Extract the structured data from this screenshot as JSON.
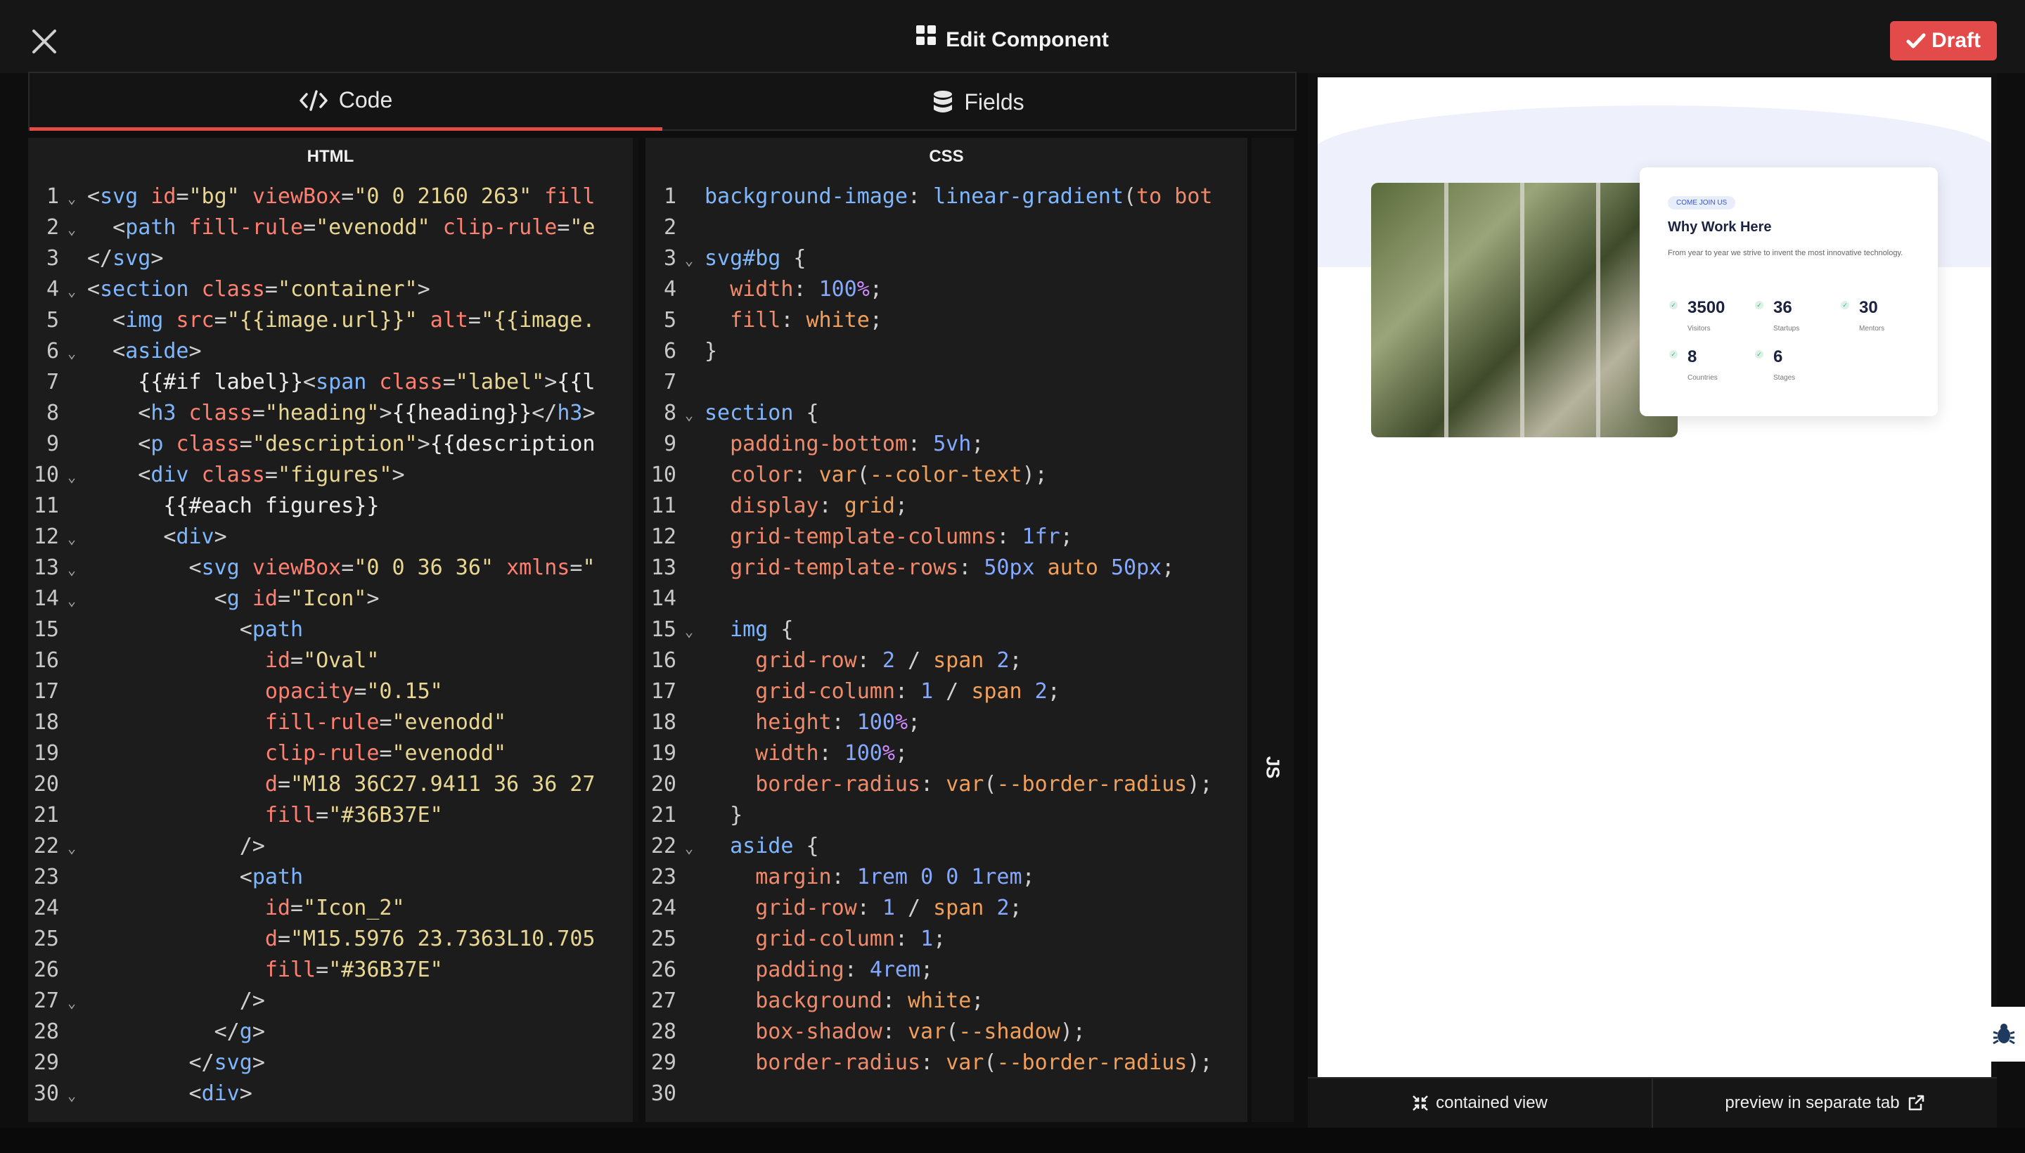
{
  "header": {
    "title": "Edit Component",
    "draft_label": "Draft"
  },
  "tabs": [
    {
      "label": "Code"
    },
    {
      "label": "Fields"
    }
  ],
  "panes": {
    "html_title": "HTML",
    "css_title": "CSS",
    "js_title": "JS"
  },
  "html_lines": [
    [
      [
        "t-punc",
        "<"
      ],
      [
        "t-tag",
        "svg"
      ],
      [
        "t-plain",
        " "
      ],
      [
        "t-attr",
        "id"
      ],
      [
        "t-punc",
        "="
      ],
      [
        "t-str",
        "\"bg\""
      ],
      [
        "t-plain",
        " "
      ],
      [
        "t-attr",
        "viewBox"
      ],
      [
        "t-punc",
        "="
      ],
      [
        "t-str",
        "\"0 0 2160 263\""
      ],
      [
        "t-plain",
        " "
      ],
      [
        "t-attr",
        "fill"
      ]
    ],
    [
      [
        "t-plain",
        "  "
      ],
      [
        "t-punc",
        "<"
      ],
      [
        "t-tag",
        "path"
      ],
      [
        "t-plain",
        " "
      ],
      [
        "t-attr",
        "fill-rule"
      ],
      [
        "t-punc",
        "="
      ],
      [
        "t-str",
        "\"evenodd\""
      ],
      [
        "t-plain",
        " "
      ],
      [
        "t-attr",
        "clip-rule"
      ],
      [
        "t-punc",
        "="
      ],
      [
        "t-str",
        "\"e"
      ]
    ],
    [
      [
        "t-punc",
        "</"
      ],
      [
        "t-tag",
        "svg"
      ],
      [
        "t-punc",
        ">"
      ]
    ],
    [
      [
        "t-punc",
        "<"
      ],
      [
        "t-tag",
        "section"
      ],
      [
        "t-plain",
        " "
      ],
      [
        "t-attr",
        "class"
      ],
      [
        "t-punc",
        "="
      ],
      [
        "t-str",
        "\"container\""
      ],
      [
        "t-punc",
        ">"
      ]
    ],
    [
      [
        "t-plain",
        "  "
      ],
      [
        "t-punc",
        "<"
      ],
      [
        "t-tag",
        "img"
      ],
      [
        "t-plain",
        " "
      ],
      [
        "t-attr",
        "src"
      ],
      [
        "t-punc",
        "="
      ],
      [
        "t-str",
        "\"{{image.url}}\""
      ],
      [
        "t-plain",
        " "
      ],
      [
        "t-attr",
        "alt"
      ],
      [
        "t-punc",
        "="
      ],
      [
        "t-str",
        "\"{{image."
      ]
    ],
    [
      [
        "t-plain",
        "  "
      ],
      [
        "t-punc",
        "<"
      ],
      [
        "t-tag",
        "aside"
      ],
      [
        "t-punc",
        ">"
      ]
    ],
    [
      [
        "t-plain",
        "    {{#if label}}"
      ],
      [
        "t-punc",
        "<"
      ],
      [
        "t-tag",
        "span"
      ],
      [
        "t-plain",
        " "
      ],
      [
        "t-attr",
        "class"
      ],
      [
        "t-punc",
        "="
      ],
      [
        "t-str",
        "\"label\""
      ],
      [
        "t-punc",
        ">"
      ],
      [
        "t-plain",
        "{{l"
      ]
    ],
    [
      [
        "t-plain",
        "    "
      ],
      [
        "t-punc",
        "<"
      ],
      [
        "t-tag",
        "h3"
      ],
      [
        "t-plain",
        " "
      ],
      [
        "t-attr",
        "class"
      ],
      [
        "t-punc",
        "="
      ],
      [
        "t-str",
        "\"heading\""
      ],
      [
        "t-punc",
        ">"
      ],
      [
        "t-plain",
        "{{heading}}"
      ],
      [
        "t-punc",
        "</"
      ],
      [
        "t-tag",
        "h3"
      ],
      [
        "t-punc",
        ">"
      ]
    ],
    [
      [
        "t-plain",
        "    "
      ],
      [
        "t-punc",
        "<"
      ],
      [
        "t-tag",
        "p"
      ],
      [
        "t-plain",
        " "
      ],
      [
        "t-attr",
        "class"
      ],
      [
        "t-punc",
        "="
      ],
      [
        "t-str",
        "\"description\""
      ],
      [
        "t-punc",
        ">"
      ],
      [
        "t-plain",
        "{{description"
      ]
    ],
    [
      [
        "t-plain",
        "    "
      ],
      [
        "t-punc",
        "<"
      ],
      [
        "t-tag",
        "div"
      ],
      [
        "t-plain",
        " "
      ],
      [
        "t-attr",
        "class"
      ],
      [
        "t-punc",
        "="
      ],
      [
        "t-str",
        "\"figures\""
      ],
      [
        "t-punc",
        ">"
      ]
    ],
    [
      [
        "t-plain",
        "      {{#each figures}}"
      ]
    ],
    [
      [
        "t-plain",
        "      "
      ],
      [
        "t-punc",
        "<"
      ],
      [
        "t-tag",
        "div"
      ],
      [
        "t-punc",
        ">"
      ]
    ],
    [
      [
        "t-plain",
        "        "
      ],
      [
        "t-punc",
        "<"
      ],
      [
        "t-tag",
        "svg"
      ],
      [
        "t-plain",
        " "
      ],
      [
        "t-attr",
        "viewBox"
      ],
      [
        "t-punc",
        "="
      ],
      [
        "t-str",
        "\"0 0 36 36\""
      ],
      [
        "t-plain",
        " "
      ],
      [
        "t-attr",
        "xmlns"
      ],
      [
        "t-punc",
        "="
      ],
      [
        "t-str",
        "\""
      ]
    ],
    [
      [
        "t-plain",
        "          "
      ],
      [
        "t-punc",
        "<"
      ],
      [
        "t-tag",
        "g"
      ],
      [
        "t-plain",
        " "
      ],
      [
        "t-attr",
        "id"
      ],
      [
        "t-punc",
        "="
      ],
      [
        "t-str",
        "\"Icon\""
      ],
      [
        "t-punc",
        ">"
      ]
    ],
    [
      [
        "t-plain",
        "            "
      ],
      [
        "t-punc",
        "<"
      ],
      [
        "t-tag",
        "path"
      ]
    ],
    [
      [
        "t-plain",
        "              "
      ],
      [
        "t-attr",
        "id"
      ],
      [
        "t-punc",
        "="
      ],
      [
        "t-str",
        "\"Oval\""
      ]
    ],
    [
      [
        "t-plain",
        "              "
      ],
      [
        "t-attr",
        "opacity"
      ],
      [
        "t-punc",
        "="
      ],
      [
        "t-str",
        "\"0.15\""
      ]
    ],
    [
      [
        "t-plain",
        "              "
      ],
      [
        "t-attr",
        "fill-rule"
      ],
      [
        "t-punc",
        "="
      ],
      [
        "t-str",
        "\"evenodd\""
      ]
    ],
    [
      [
        "t-plain",
        "              "
      ],
      [
        "t-attr",
        "clip-rule"
      ],
      [
        "t-punc",
        "="
      ],
      [
        "t-str",
        "\"evenodd\""
      ]
    ],
    [
      [
        "t-plain",
        "              "
      ],
      [
        "t-attr",
        "d"
      ],
      [
        "t-punc",
        "="
      ],
      [
        "t-str",
        "\"M18 36C27.9411 36 36 27"
      ]
    ],
    [
      [
        "t-plain",
        "              "
      ],
      [
        "t-attr",
        "fill"
      ],
      [
        "t-punc",
        "="
      ],
      [
        "t-str",
        "\"#36B37E\""
      ]
    ],
    [
      [
        "t-plain",
        "            "
      ],
      [
        "t-punc",
        "/>"
      ]
    ],
    [
      [
        "t-plain",
        "            "
      ],
      [
        "t-punc",
        "<"
      ],
      [
        "t-tag",
        "path"
      ]
    ],
    [
      [
        "t-plain",
        "              "
      ],
      [
        "t-attr",
        "id"
      ],
      [
        "t-punc",
        "="
      ],
      [
        "t-str",
        "\"Icon_2\""
      ]
    ],
    [
      [
        "t-plain",
        "              "
      ],
      [
        "t-attr",
        "d"
      ],
      [
        "t-punc",
        "="
      ],
      [
        "t-str",
        "\"M15.5976 23.7363L10.705"
      ]
    ],
    [
      [
        "t-plain",
        "              "
      ],
      [
        "t-attr",
        "fill"
      ],
      [
        "t-punc",
        "="
      ],
      [
        "t-str",
        "\"#36B37E\""
      ]
    ],
    [
      [
        "t-plain",
        "            "
      ],
      [
        "t-punc",
        "/>"
      ]
    ],
    [
      [
        "t-plain",
        "          "
      ],
      [
        "t-punc",
        "</"
      ],
      [
        "t-tag",
        "g"
      ],
      [
        "t-punc",
        ">"
      ]
    ],
    [
      [
        "t-plain",
        "        "
      ],
      [
        "t-punc",
        "</"
      ],
      [
        "t-tag",
        "svg"
      ],
      [
        "t-punc",
        ">"
      ]
    ],
    [
      [
        "t-plain",
        "        "
      ],
      [
        "t-punc",
        "<"
      ],
      [
        "t-tag",
        "div"
      ],
      [
        "t-punc",
        ">"
      ]
    ]
  ],
  "html_folds": [
    1,
    2,
    4,
    6,
    10,
    12,
    13,
    14,
    22,
    27,
    30
  ],
  "css_lines": [
    [
      [
        "t-fn",
        "background-image"
      ],
      [
        "t-punc",
        ": "
      ],
      [
        "t-fn",
        "linear-gradient"
      ],
      [
        "t-punc",
        "("
      ],
      [
        "t-kw",
        "to bot"
      ]
    ],
    [],
    [
      [
        "t-fn",
        "svg#bg"
      ],
      [
        "t-punc",
        " {"
      ]
    ],
    [
      [
        "t-plain",
        "  "
      ],
      [
        "t-kw",
        "width"
      ],
      [
        "t-punc",
        ": "
      ],
      [
        "t-num",
        "100"
      ],
      [
        "t-pct",
        "%"
      ],
      [
        "t-punc",
        ";"
      ]
    ],
    [
      [
        "t-plain",
        "  "
      ],
      [
        "t-kw",
        "fill"
      ],
      [
        "t-punc",
        ": "
      ],
      [
        "t-val",
        "white"
      ],
      [
        "t-punc",
        ";"
      ]
    ],
    [
      [
        "t-punc",
        "}"
      ]
    ],
    [],
    [
      [
        "t-fn",
        "section"
      ],
      [
        "t-punc",
        " {"
      ]
    ],
    [
      [
        "t-plain",
        "  "
      ],
      [
        "t-kw",
        "padding-bottom"
      ],
      [
        "t-punc",
        ": "
      ],
      [
        "t-num",
        "5vh"
      ],
      [
        "t-punc",
        ";"
      ]
    ],
    [
      [
        "t-plain",
        "  "
      ],
      [
        "t-kw",
        "color"
      ],
      [
        "t-punc",
        ": "
      ],
      [
        "t-val",
        "var"
      ],
      [
        "t-punc",
        "("
      ],
      [
        "t-val",
        "--color-text"
      ],
      [
        "t-punc",
        ");"
      ]
    ],
    [
      [
        "t-plain",
        "  "
      ],
      [
        "t-kw",
        "display"
      ],
      [
        "t-punc",
        ": "
      ],
      [
        "t-val",
        "grid"
      ],
      [
        "t-punc",
        ";"
      ]
    ],
    [
      [
        "t-plain",
        "  "
      ],
      [
        "t-kw",
        "grid-template-columns"
      ],
      [
        "t-punc",
        ": "
      ],
      [
        "t-num",
        "1fr"
      ],
      [
        "t-punc",
        ";"
      ]
    ],
    [
      [
        "t-plain",
        "  "
      ],
      [
        "t-kw",
        "grid-template-rows"
      ],
      [
        "t-punc",
        ": "
      ],
      [
        "t-num",
        "50px"
      ],
      [
        "t-plain",
        " "
      ],
      [
        "t-val",
        "auto"
      ],
      [
        "t-plain",
        " "
      ],
      [
        "t-num",
        "50px"
      ],
      [
        "t-punc",
        ";"
      ]
    ],
    [],
    [
      [
        "t-plain",
        "  "
      ],
      [
        "t-fn",
        "img"
      ],
      [
        "t-punc",
        " {"
      ]
    ],
    [
      [
        "t-plain",
        "    "
      ],
      [
        "t-kw",
        "grid-row"
      ],
      [
        "t-punc",
        ": "
      ],
      [
        "t-num",
        "2"
      ],
      [
        "t-punc",
        " / "
      ],
      [
        "t-val",
        "span"
      ],
      [
        "t-plain",
        " "
      ],
      [
        "t-num",
        "2"
      ],
      [
        "t-punc",
        ";"
      ]
    ],
    [
      [
        "t-plain",
        "    "
      ],
      [
        "t-kw",
        "grid-column"
      ],
      [
        "t-punc",
        ": "
      ],
      [
        "t-num",
        "1"
      ],
      [
        "t-punc",
        " / "
      ],
      [
        "t-val",
        "span"
      ],
      [
        "t-plain",
        " "
      ],
      [
        "t-num",
        "2"
      ],
      [
        "t-punc",
        ";"
      ]
    ],
    [
      [
        "t-plain",
        "    "
      ],
      [
        "t-kw",
        "height"
      ],
      [
        "t-punc",
        ": "
      ],
      [
        "t-num",
        "100"
      ],
      [
        "t-pct",
        "%"
      ],
      [
        "t-punc",
        ";"
      ]
    ],
    [
      [
        "t-plain",
        "    "
      ],
      [
        "t-kw",
        "width"
      ],
      [
        "t-punc",
        ": "
      ],
      [
        "t-num",
        "100"
      ],
      [
        "t-pct",
        "%"
      ],
      [
        "t-punc",
        ";"
      ]
    ],
    [
      [
        "t-plain",
        "    "
      ],
      [
        "t-kw",
        "border-radius"
      ],
      [
        "t-punc",
        ": "
      ],
      [
        "t-val",
        "var"
      ],
      [
        "t-punc",
        "("
      ],
      [
        "t-val",
        "--border-radius"
      ],
      [
        "t-punc",
        ");"
      ]
    ],
    [
      [
        "t-plain",
        "  "
      ],
      [
        "t-punc",
        "}"
      ]
    ],
    [
      [
        "t-plain",
        "  "
      ],
      [
        "t-fn",
        "aside"
      ],
      [
        "t-punc",
        " {"
      ]
    ],
    [
      [
        "t-plain",
        "    "
      ],
      [
        "t-kw",
        "margin"
      ],
      [
        "t-punc",
        ": "
      ],
      [
        "t-num",
        "1rem"
      ],
      [
        "t-plain",
        " "
      ],
      [
        "t-num",
        "0"
      ],
      [
        "t-plain",
        " "
      ],
      [
        "t-num",
        "0"
      ],
      [
        "t-plain",
        " "
      ],
      [
        "t-num",
        "1rem"
      ],
      [
        "t-punc",
        ";"
      ]
    ],
    [
      [
        "t-plain",
        "    "
      ],
      [
        "t-kw",
        "grid-row"
      ],
      [
        "t-punc",
        ": "
      ],
      [
        "t-num",
        "1"
      ],
      [
        "t-punc",
        " / "
      ],
      [
        "t-val",
        "span"
      ],
      [
        "t-plain",
        " "
      ],
      [
        "t-num",
        "2"
      ],
      [
        "t-punc",
        ";"
      ]
    ],
    [
      [
        "t-plain",
        "    "
      ],
      [
        "t-kw",
        "grid-column"
      ],
      [
        "t-punc",
        ": "
      ],
      [
        "t-num",
        "1"
      ],
      [
        "t-punc",
        ";"
      ]
    ],
    [
      [
        "t-plain",
        "    "
      ],
      [
        "t-kw",
        "padding"
      ],
      [
        "t-punc",
        ": "
      ],
      [
        "t-num",
        "4rem"
      ],
      [
        "t-punc",
        ";"
      ]
    ],
    [
      [
        "t-plain",
        "    "
      ],
      [
        "t-kw",
        "background"
      ],
      [
        "t-punc",
        ": "
      ],
      [
        "t-val",
        "white"
      ],
      [
        "t-punc",
        ";"
      ]
    ],
    [
      [
        "t-plain",
        "    "
      ],
      [
        "t-kw",
        "box-shadow"
      ],
      [
        "t-punc",
        ": "
      ],
      [
        "t-val",
        "var"
      ],
      [
        "t-punc",
        "("
      ],
      [
        "t-val",
        "--shadow"
      ],
      [
        "t-punc",
        ");"
      ]
    ],
    [
      [
        "t-plain",
        "    "
      ],
      [
        "t-kw",
        "border-radius"
      ],
      [
        "t-punc",
        ": "
      ],
      [
        "t-val",
        "var"
      ],
      [
        "t-punc",
        "("
      ],
      [
        "t-val",
        "--border-radius"
      ],
      [
        "t-punc",
        ");"
      ]
    ],
    []
  ],
  "css_folds": [
    3,
    8,
    15,
    22
  ],
  "preview": {
    "label": "COME JOIN US",
    "heading": "Why Work Here",
    "description": "From year to year we strive to invent the most innovative technology.",
    "figures": [
      {
        "value": "3500",
        "name": "Visitors"
      },
      {
        "value": "36",
        "name": "Startups"
      },
      {
        "value": "30",
        "name": "Mentors"
      },
      {
        "value": "8",
        "name": "Countries"
      },
      {
        "value": "6",
        "name": "Stages"
      }
    ]
  },
  "preview_bar": {
    "contained": "contained view",
    "separate": "preview in separate tab"
  },
  "colors": {
    "accent": "#e14c44",
    "draft": "#e34b4b",
    "check": "#36b37e"
  }
}
